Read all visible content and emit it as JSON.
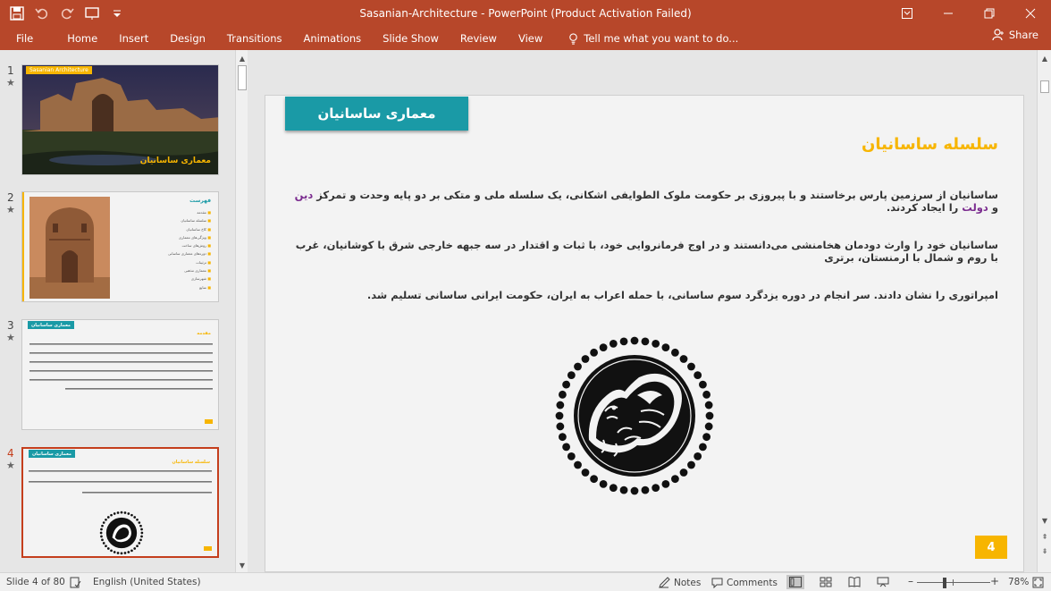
{
  "app": {
    "window_title": "Sasanian-Architecture - PowerPoint (Product Activation Failed)",
    "share_label": "Share",
    "tell_me": "Tell me what you want to do..."
  },
  "ribbon": {
    "tabs": [
      "File",
      "Home",
      "Insert",
      "Design",
      "Transitions",
      "Animations",
      "Slide Show",
      "Review",
      "View"
    ]
  },
  "thumbnails": [
    {
      "num": "1",
      "star": "★",
      "label": "Sasanian Architecture",
      "title": "معماری ساسانیان"
    },
    {
      "num": "2",
      "star": "★",
      "toc_title": "فهرست",
      "toc_items": [
        "مقدمه",
        "سلسله ساسانیان",
        "کاخ ساسانیان",
        "ویژگی‌های معماری",
        "روش‌های ساخت",
        "دوره‌های معماری ساسانی",
        "تزئینات",
        "معماری مذهبی",
        "شهرسازی",
        "منابع"
      ]
    },
    {
      "num": "3",
      "star": "★",
      "title": "معماری ساسانیان",
      "heading": "مقدمه"
    },
    {
      "num": "4",
      "star": "★",
      "title": "معماری ساسانیان",
      "heading": "سلسله ساسانیان"
    }
  ],
  "slide": {
    "title": "معماری ساسانیان",
    "heading": "سلسله ساسانیان",
    "para1_a": "ساسانیان از سرزمین پارس برخاستند و با پیروزی بر حکومت ملوک الطوایفی اشکانی، یک سلسله ملی و متکی بر دو پایه وحدت و تمرکز",
    "para1_hl1": "دین",
    "para1_and": "و",
    "para1_hl2": "دولت",
    "para1_b": "را ایجاد کردند.",
    "para2": "ساسانیان خود را وارث دودمان هخامنشی می‌دانستند و در اوج فرمانروایی خود، با ثبات و اقتدار در سه جبهه خارجی شرق با کوشانیان، غرب با روم و شمال با ارمنستان، برتری",
    "para3": "امپراتوری را نشان دادند. سر انجام در دوره یزدگرد سوم ساسانی، با حمله اعراب به ایران، حکومت ایرانی ساسانی تسلیم شد.",
    "number": "4",
    "emblem_icon": "sasanian-simurgh-emblem-icon"
  },
  "status": {
    "slide_of": "Slide 4 of 80",
    "language": "English (United States)",
    "notes": "Notes",
    "comments": "Comments",
    "zoom": "78%",
    "zoom_fraction": 0.78
  },
  "colors": {
    "ribbon": "#b7472a",
    "accent_teal": "#1a9aa6",
    "accent_yellow": "#f7b500",
    "highlight_purple": "#7b2c8f"
  }
}
